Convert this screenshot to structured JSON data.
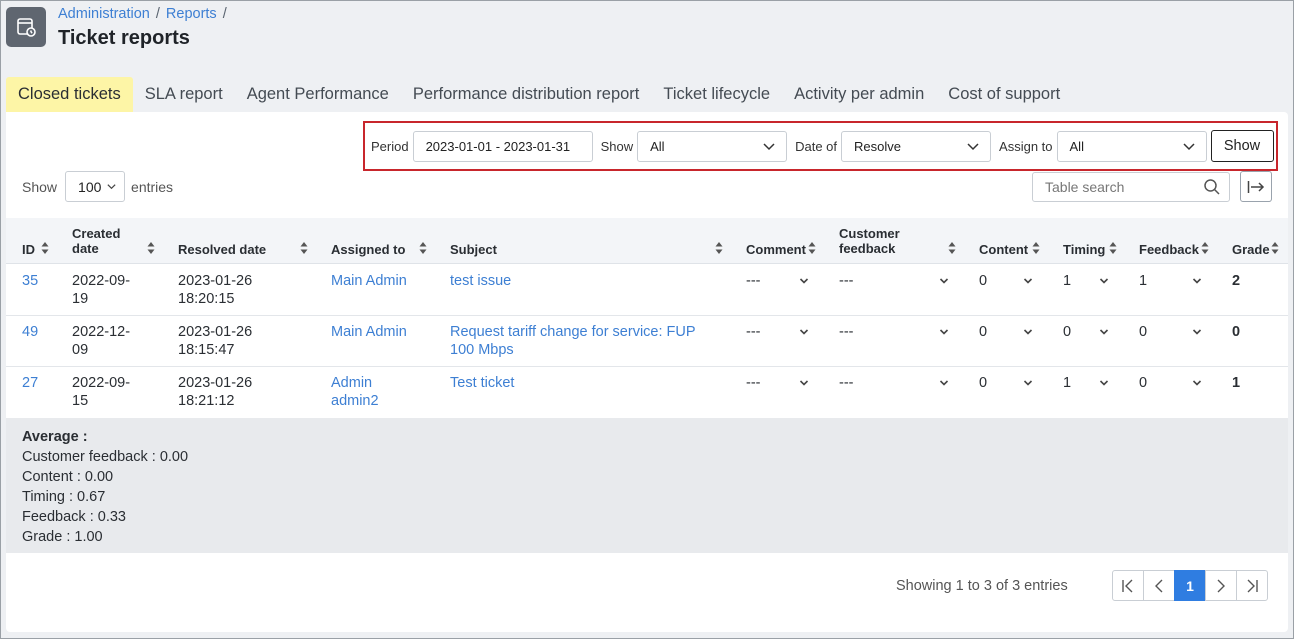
{
  "header": {
    "breadcrumb": [
      "Administration",
      "Reports"
    ],
    "title": "Ticket reports"
  },
  "tabs": [
    {
      "label": "Closed tickets",
      "active": true
    },
    {
      "label": "SLA report"
    },
    {
      "label": "Agent Performance"
    },
    {
      "label": "Performance distribution report"
    },
    {
      "label": "Ticket lifecycle"
    },
    {
      "label": "Activity per admin"
    },
    {
      "label": "Cost of support"
    }
  ],
  "filters": {
    "period_label": "Period",
    "period_value": "2023-01-01 - 2023-01-31",
    "show_label": "Show",
    "show_value": "All",
    "dateof_label": "Date of",
    "dateof_value": "Resolve",
    "assign_label": "Assign to",
    "assign_value": "All",
    "button": "Show"
  },
  "entries": {
    "prefix": "Show",
    "value": "100",
    "suffix": "entries"
  },
  "search": {
    "placeholder": "Table search"
  },
  "table": {
    "columns": {
      "id": "ID",
      "created_1": "Created",
      "created_2": "date",
      "resolved": "Resolved date",
      "assigned": "Assigned to",
      "subject": "Subject",
      "comment": "Comment",
      "feedback_1": "Customer",
      "feedback_2": "feedback",
      "content": "Content",
      "timing": "Timing",
      "feedback": "Feedback",
      "grade": "Grade"
    },
    "rows": [
      {
        "id": "35",
        "created_1": "2022-09-",
        "created_2": "19",
        "resolved_1": "2023-01-26",
        "resolved_2": "18:20:15",
        "assigned_1": "Main Admin",
        "assigned_2": "",
        "subject_1": "test issue",
        "subject_2": "",
        "comment": "---",
        "customer_feedback": "---",
        "content": "0",
        "timing": "1",
        "feedback": "1",
        "grade": "2"
      },
      {
        "id": "49",
        "created_1": "2022-12-",
        "created_2": "09",
        "resolved_1": "2023-01-26",
        "resolved_2": "18:15:47",
        "assigned_1": "Main Admin",
        "assigned_2": "",
        "subject_1": "Request tariff change for service: FUP",
        "subject_2": "100 Mbps",
        "comment": "---",
        "customer_feedback": "---",
        "content": "0",
        "timing": "0",
        "feedback": "0",
        "grade": "0"
      },
      {
        "id": "27",
        "created_1": "2022-09-",
        "created_2": "15",
        "resolved_1": "2023-01-26",
        "resolved_2": "18:21:12",
        "assigned_1": "Admin",
        "assigned_2": "admin2",
        "subject_1": "Test ticket",
        "subject_2": "",
        "comment": "---",
        "customer_feedback": "---",
        "content": "0",
        "timing": "1",
        "feedback": "0",
        "grade": "1"
      }
    ]
  },
  "averages": {
    "heading": "Average :",
    "lines": [
      "Customer feedback : 0.00",
      "Content : 0.00",
      "Timing : 0.67",
      "Feedback : 0.33",
      "Grade : 1.00"
    ]
  },
  "pagination": {
    "info": "Showing 1 to 3 of 3 entries",
    "current_page": "1"
  },
  "colors": {
    "accent": "#2f7de1",
    "link": "#3d7fd3",
    "active_tab": "#fdf5a6",
    "highlight_border": "#c8262c"
  },
  "icons": [
    "report-page-icon",
    "chevron-down-icon",
    "sort-icon",
    "search-icon",
    "export-icon",
    "first-page-icon",
    "prev-page-icon",
    "next-page-icon",
    "last-page-icon"
  ]
}
